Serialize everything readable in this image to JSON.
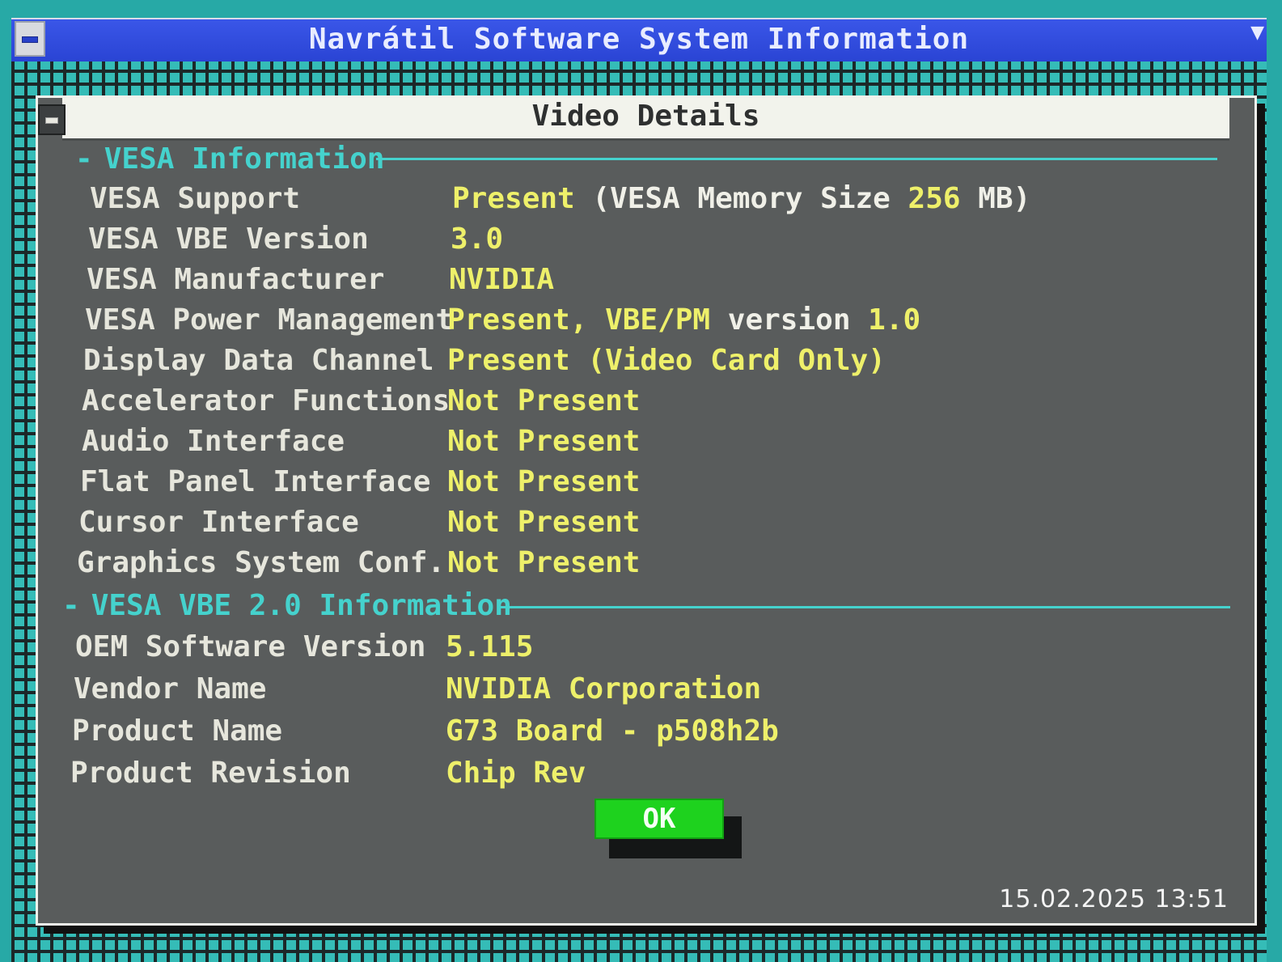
{
  "app": {
    "title": "Navrátil Software System Information"
  },
  "dialog": {
    "title": "Video Details",
    "sections": [
      {
        "heading": "VESA Information",
        "rows": [
          {
            "label": "VESA Support",
            "value": "Present",
            "value_extra": " (VESA Memory Size ",
            "value_num": "256",
            "value_unit": " MB)"
          },
          {
            "label": "VESA VBE Version",
            "value": "3.0"
          },
          {
            "label": "VESA Manufacturer",
            "value": "NVIDIA"
          },
          {
            "label": "VESA Power Management",
            "value": "Present, VBE/PM ",
            "value_extra": "version",
            "value_num": " 1.0"
          },
          {
            "label": "Display Data Channel",
            "value": "Present (Video Card Only)"
          },
          {
            "label": "Accelerator Functions",
            "value": "Not Present"
          },
          {
            "label": "Audio Interface",
            "value": "Not Present"
          },
          {
            "label": "Flat Panel Interface",
            "value": "Not Present"
          },
          {
            "label": "Cursor Interface",
            "value": "Not Present"
          },
          {
            "label": "Graphics System Conf.",
            "value": "Not Present"
          }
        ]
      },
      {
        "heading": "VESA VBE 2.0 Information",
        "rows": [
          {
            "label": "OEM Software Version",
            "value": "5.115"
          },
          {
            "label": "Vendor Name",
            "value": "NVIDIA Corporation"
          },
          {
            "label": "Product Name",
            "value": "G73 Board - p508h2b"
          },
          {
            "label": "Product Revision",
            "value": "Chip Rev"
          }
        ]
      }
    ],
    "ok_label": "OK",
    "dash": "-"
  },
  "timestamp": "15.02.2025 13:51",
  "colors": {
    "titlebar": "#2a44d4",
    "dialog_bg": "#595c5c",
    "heading": "#45d2cd",
    "label": "#e6e6dc",
    "value": "#eef06a",
    "ok_button": "#1ed21e",
    "grid": "#35bcb7"
  }
}
